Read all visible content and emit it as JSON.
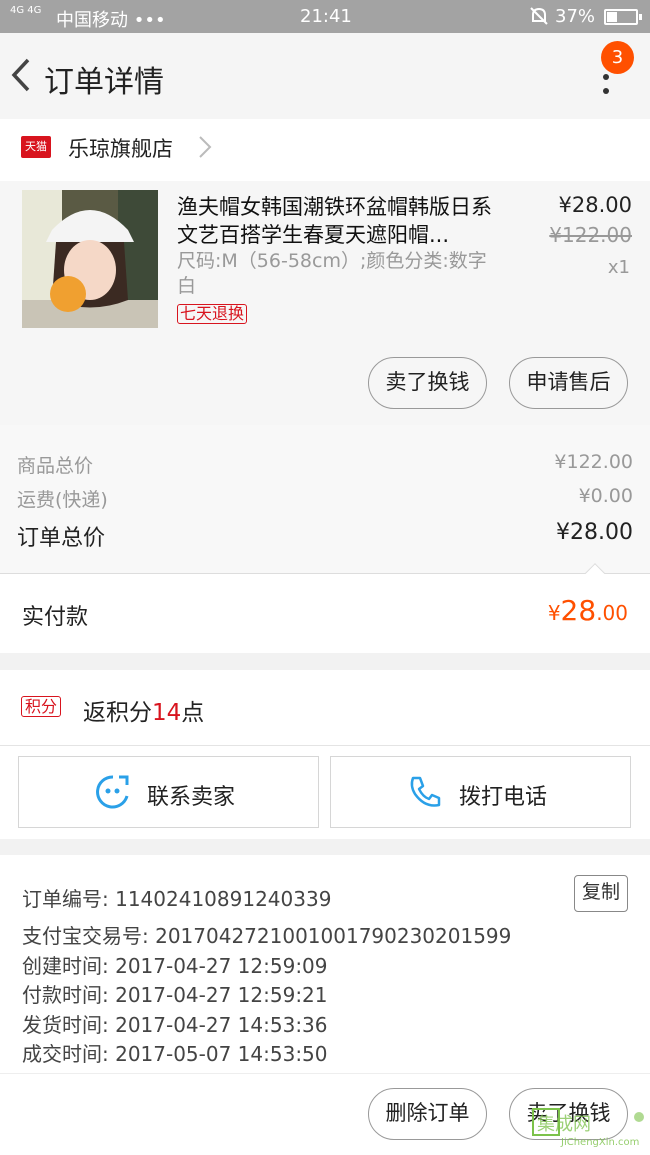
{
  "status_bar": {
    "signal": "4G 4G",
    "carrier": "中国移动 •••",
    "time": "21:41",
    "battery": "37%"
  },
  "header": {
    "title": "订单详情",
    "badge_count": "3"
  },
  "store": {
    "badge": "天猫",
    "name": "乐琼旗舰店"
  },
  "product": {
    "title": "渔夫帽女韩国潮铁环盆帽韩版日系文艺百搭学生春夏天遮阳帽...",
    "spec": "尺码:M（56-58cm）;颜色分类:数字白",
    "return_tag": "七天退换",
    "price": "¥28.00",
    "original_price": "¥122.00",
    "quantity": "x1",
    "sell_button": "卖了换钱",
    "after_sale_button": "申请售后"
  },
  "summary": {
    "goods_total_label": "商品总价",
    "goods_total_value": "¥122.00",
    "shipping_label": "运费(快递)",
    "shipping_value": "¥0.00",
    "order_total_label": "订单总价",
    "order_total_value": "¥28.00"
  },
  "paid": {
    "label": "实付款",
    "currency": "¥",
    "amount_int": "28",
    "amount_dec": ".00"
  },
  "points": {
    "tag": "积分",
    "prefix": "返积分",
    "count": "14",
    "suffix": "点"
  },
  "contact": {
    "seller_button": "联系卖家",
    "call_button": "拨打电话"
  },
  "order_info": {
    "order_no": "订单编号: 11402410891240339",
    "copy_button": "复制",
    "alipay_no": "支付宝交易号: 2017042721001001790230201599",
    "created": "创建时间: 2017-04-27 12:59:09",
    "paid": "付款时间: 2017-04-27 12:59:21",
    "shipped": "发货时间: 2017-04-27 14:53:36",
    "completed": "成交时间: 2017-05-07 14:53:50"
  },
  "actions": {
    "delete_button": "删除订单",
    "sell_button": "卖了换钱"
  },
  "watermark": {
    "brand": "集成网",
    "url": "JiChengXin.com"
  },
  "colors": {
    "accent": "#ff5000",
    "tmall_red": "#d8141e",
    "muted": "#999999"
  }
}
